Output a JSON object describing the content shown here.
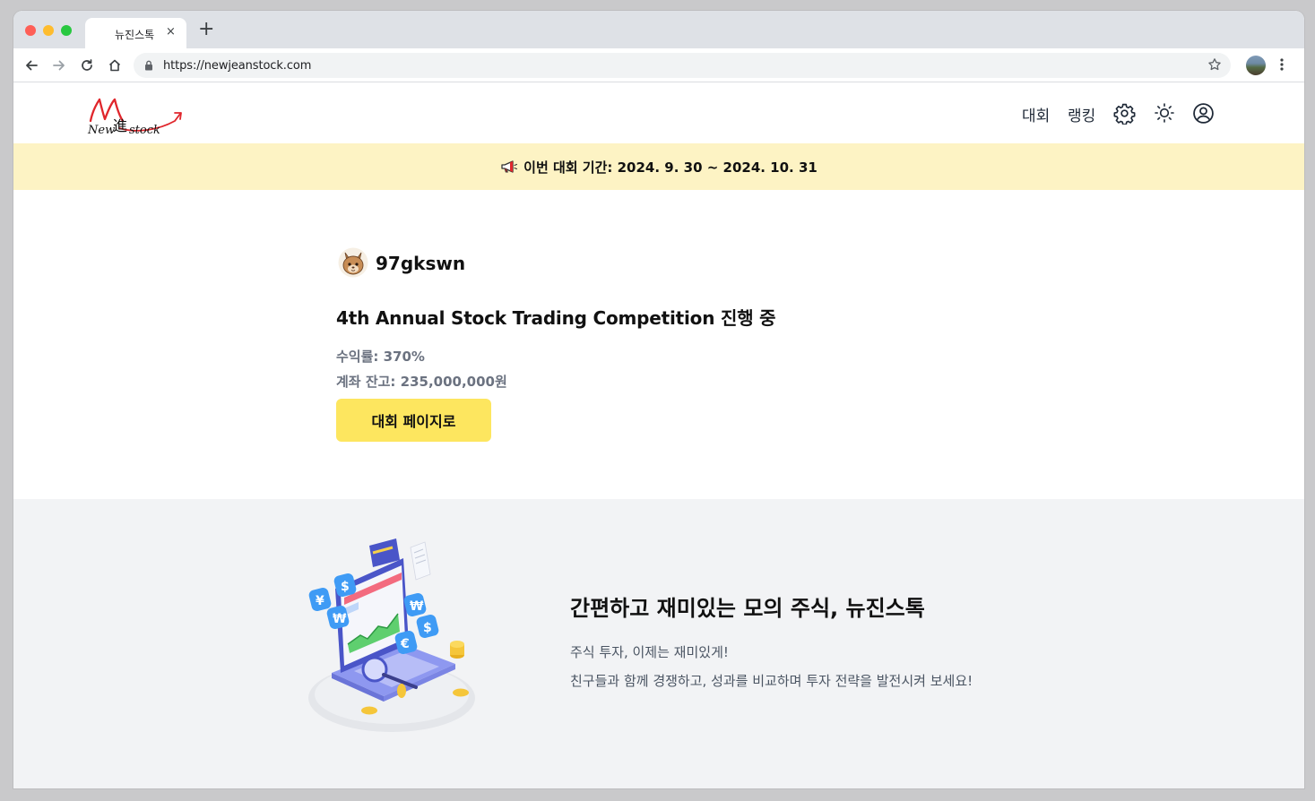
{
  "browser": {
    "tab_title": "뉴진스톡",
    "tab_close": "×",
    "new_tab": "+",
    "url": "https://newjeanstock.com"
  },
  "header": {
    "logo_text": "New進stock",
    "nav": {
      "competition": "대회",
      "ranking": "랭킹"
    },
    "icons": [
      "gear-icon",
      "sun-icon",
      "user-circle-icon"
    ]
  },
  "banner": {
    "icon": "megaphone-icon",
    "text": "이번 대회 기간: 2024. 9. 30 ~ 2024. 10. 31"
  },
  "profile": {
    "username": "97gkswn",
    "competition_status": "4th Annual Stock Trading Competition 진행 중",
    "return_rate": "수익률: 370%",
    "balance": "계좌 잔고: 235,000,000원",
    "cta_label": "대회 페이지로"
  },
  "promo": {
    "title": "간편하고 재미있는 모의 주식, 뉴진스톡",
    "line1": "주식 투자, 이제는 재미있게!",
    "line2": "친구들과 함께 경쟁하고, 성과를 비교하며 투자 전략을 발전시켜 보세요!"
  },
  "colors": {
    "banner_bg": "#fdf3c4",
    "cta_bg": "#fde65f",
    "promo_bg": "#f2f3f5",
    "logo_red": "#e0262c"
  }
}
